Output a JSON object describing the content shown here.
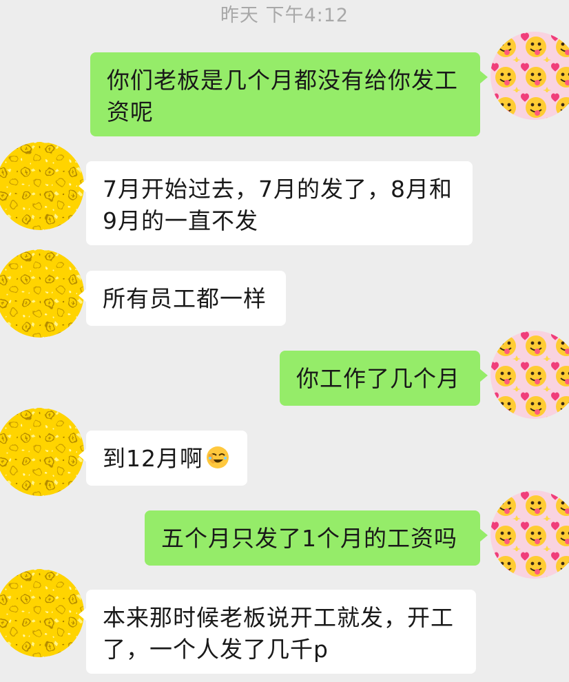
{
  "chat": {
    "timestamp": "昨天 下午4:12",
    "messages": [
      {
        "side": "out",
        "text": "你们老板是几个月都没有给你发工资呢"
      },
      {
        "side": "in",
        "text": "7月开始过去，7月的发了，8月和9月的一直不发"
      },
      {
        "side": "in",
        "text": "所有员工都一样"
      },
      {
        "side": "out",
        "text": "你工作了几个月"
      },
      {
        "side": "in",
        "text": "到12月啊",
        "emoji": "face-palm-laughing-emoji"
      },
      {
        "side": "out",
        "text": "五个月只发了1个月的工资吗"
      },
      {
        "side": "in",
        "text": "本来那时候老板说开工就发，开工了，一个人发了几千p"
      }
    ]
  },
  "theme": {
    "background": "#ededed",
    "outgoing_bubble": "#95ec69",
    "incoming_bubble": "#ffffff",
    "timestamp_color": "#a8a8a8"
  },
  "avatars": {
    "self": "tongue-heart-emoji-avatar",
    "contact": "gold-glitter-coins-avatar"
  }
}
